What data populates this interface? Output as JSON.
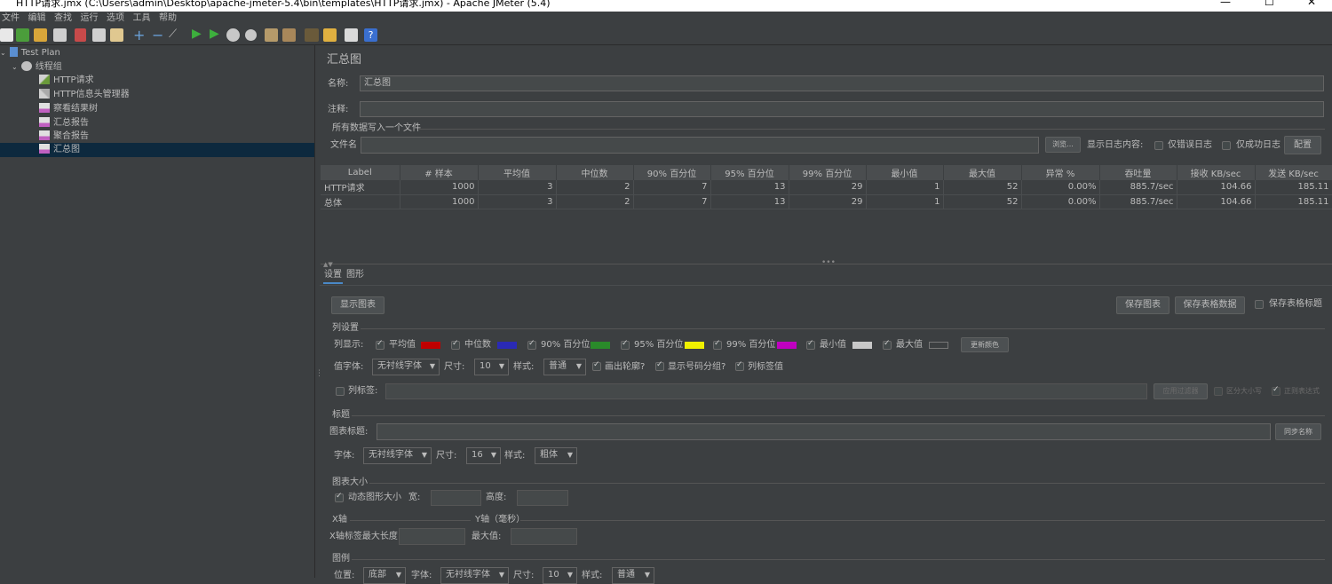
{
  "window": {
    "title": "HTTP请求.jmx (C:\\Users\\admin\\Desktop\\apache-jmeter-5.4\\bin\\templates\\HTTP请求.jmx) - Apache JMeter (5.4)",
    "minimize": "—",
    "maximize": "☐",
    "close": "✕"
  },
  "menu": [
    "文件",
    "编辑",
    "查找",
    "运行",
    "选项",
    "工具",
    "帮助"
  ],
  "tree": {
    "root": "Test Plan",
    "thread_group": "线程组",
    "items": [
      "HTTP请求",
      "HTTP信息头管理器",
      "察看结果树",
      "汇总报告",
      "聚合报告",
      "汇总图"
    ]
  },
  "panel": {
    "title": "汇总图",
    "name_label": "名称:",
    "name_value": "汇总图",
    "comment_label": "注释:",
    "comment_value": "",
    "file_section": "所有数据写入一个文件",
    "filename_label": "文件名",
    "browse": "浏览...",
    "log_label": "显示日志内容:",
    "errors_only": "仅错误日志",
    "success_only": "仅成功日志",
    "configure": "配置"
  },
  "table": {
    "headers": [
      "Label",
      "# 样本",
      "平均值",
      "中位数",
      "90% 百分位",
      "95% 百分位",
      "99% 百分位",
      "最小值",
      "最大值",
      "异常 %",
      "吞吐量",
      "接收 KB/sec",
      "发送 KB/sec"
    ],
    "rows": [
      [
        "HTTP请求",
        "1000",
        "3",
        "2",
        "7",
        "13",
        "29",
        "1",
        "52",
        "0.00%",
        "885.7/sec",
        "104.66",
        "185.11"
      ],
      [
        "总体",
        "1000",
        "3",
        "2",
        "7",
        "13",
        "29",
        "1",
        "52",
        "0.00%",
        "885.7/sec",
        "104.66",
        "185.11"
      ]
    ]
  },
  "tabs": [
    "设置",
    "图形"
  ],
  "graph": {
    "display_graph": "显示图表",
    "save_graph": "保存图表",
    "save_table": "保存表格数据",
    "save_table_header": "保存表格标题",
    "column_settings": "列设置",
    "columns_label": "列显示:",
    "columns": [
      {
        "label": "平均值",
        "color": "#c00000"
      },
      {
        "label": "中位数",
        "color": "#2a2ab5"
      },
      {
        "label": "90% 百分位",
        "color": "#2a8a2a"
      },
      {
        "label": "95% 百分位",
        "color": "#f0f000"
      },
      {
        "label": "99% 百分位",
        "color": "#c000c0"
      },
      {
        "label": "最小值",
        "color": "#c8c8c8"
      },
      {
        "label": "最大值",
        "color": "#3c3f41"
      }
    ],
    "change_color": "更新颜色",
    "value_font_label": "值字体:",
    "value_font": "无衬线字体",
    "size_label": "尺寸:",
    "value_size": "10",
    "style_label": "样式:",
    "value_style": "普通",
    "draw_outline": "画出轮廓?",
    "show_grouping": "显示号码分组?",
    "column_labels": "列标签值",
    "col_label_filter": "列标签:",
    "apply_filter": "应用过滤器",
    "case_sensitive": "区分大小写",
    "regex": "正则表达式",
    "title_section": "标题",
    "chart_title_label": "图表标题:",
    "sync_name": "同步名称",
    "title_font_label": "字体:",
    "title_font": "无衬线字体",
    "title_size": "16",
    "title_style": "粗体",
    "size_section": "图表大小",
    "dynamic_size": "动态图形大小",
    "width_label": "宽:",
    "height_label": "高度:",
    "xaxis": "X轴",
    "yaxis": "Y轴（毫秒）",
    "x_max_label": "X轴标签最大长度",
    "y_max_label": "最大值:",
    "legend_section": "图例",
    "position_label": "位置:",
    "position": "底部",
    "legend_font": "无衬线字体",
    "legend_size": "10",
    "legend_style": "普通"
  }
}
